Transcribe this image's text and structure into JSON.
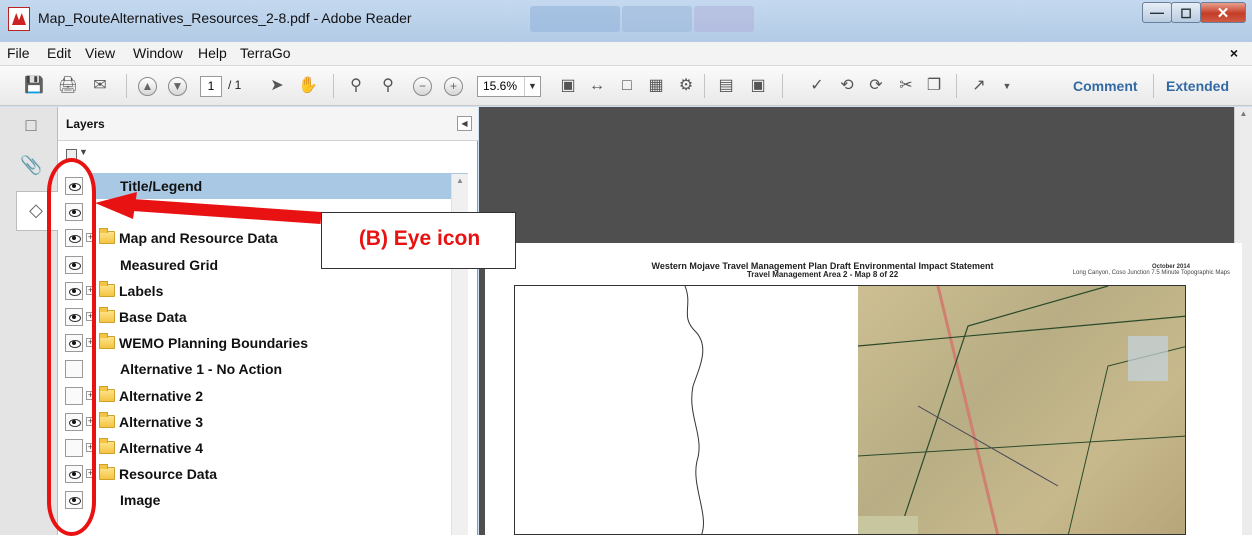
{
  "window": {
    "title": "Map_RouteAlternatives_Resources_2-8.pdf - Adobe Reader",
    "buttons": [
      "minimize",
      "maximize",
      "close"
    ]
  },
  "menubar": {
    "items": [
      "File",
      "Edit",
      "View",
      "Window",
      "Help",
      "TerraGo"
    ],
    "close_glyph": "×"
  },
  "toolbar": {
    "page_current": "1",
    "page_total": "/ 1",
    "zoom": "15.6%",
    "comment_label": "Comment",
    "extended_label": "Extended",
    "icons": [
      "save-icon",
      "print-icon",
      "email-icon",
      "prev-page-icon",
      "next-page-icon",
      "select-tool-icon",
      "hand-tool-icon",
      "marquee-zoom-icon",
      "dynamic-zoom-icon",
      "zoom-out-icon",
      "zoom-in-icon",
      "actual-size-icon",
      "fit-width-icon",
      "fit-page-icon",
      "export-icon",
      "stamp-icon",
      "split-icon",
      "tool-icon",
      "spell-icon",
      "undo-icon",
      "redo-icon",
      "cut-icon",
      "copy-icon",
      "fullscreen-icon"
    ]
  },
  "navrail": {
    "items": [
      "pages-icon",
      "attachments-icon",
      "layers-icon"
    ]
  },
  "layers_panel": {
    "title": "Layers",
    "layers": [
      {
        "name": "Title/Legend",
        "visible": true,
        "folder": false,
        "selected": true
      },
      {
        "name": "",
        "visible": true,
        "folder": false,
        "selected": false
      },
      {
        "name": "Map and Resource Data",
        "visible": true,
        "folder": true,
        "selected": false
      },
      {
        "name": "Measured Grid",
        "visible": true,
        "folder": false,
        "selected": false
      },
      {
        "name": "Labels",
        "visible": true,
        "folder": true,
        "selected": false
      },
      {
        "name": "Base Data",
        "visible": true,
        "folder": true,
        "selected": false
      },
      {
        "name": "WEMO Planning Boundaries",
        "visible": true,
        "folder": true,
        "selected": false
      },
      {
        "name": "Alternative 1 - No Action",
        "visible": false,
        "folder": false,
        "selected": false
      },
      {
        "name": "Alternative 2",
        "visible": false,
        "folder": true,
        "selected": false
      },
      {
        "name": "Alternative 3",
        "visible": true,
        "folder": true,
        "selected": false
      },
      {
        "name": "Alternative 4",
        "visible": false,
        "folder": true,
        "selected": false
      },
      {
        "name": "Resource Data",
        "visible": true,
        "folder": true,
        "selected": false
      },
      {
        "name": "Image",
        "visible": true,
        "folder": false,
        "selected": false
      }
    ]
  },
  "document": {
    "title_line1": "Western Mojave Travel Management Plan Draft Environmental Impact Statement",
    "title_line2": "Travel Management Area 2 - Map 8 of 22",
    "date": "October 2014",
    "subtitle": "Long Canyon, Coso Junction 7.5 Minute Topographic Maps"
  },
  "annotation": {
    "label": "(B) Eye icon",
    "color": "#e81212"
  }
}
